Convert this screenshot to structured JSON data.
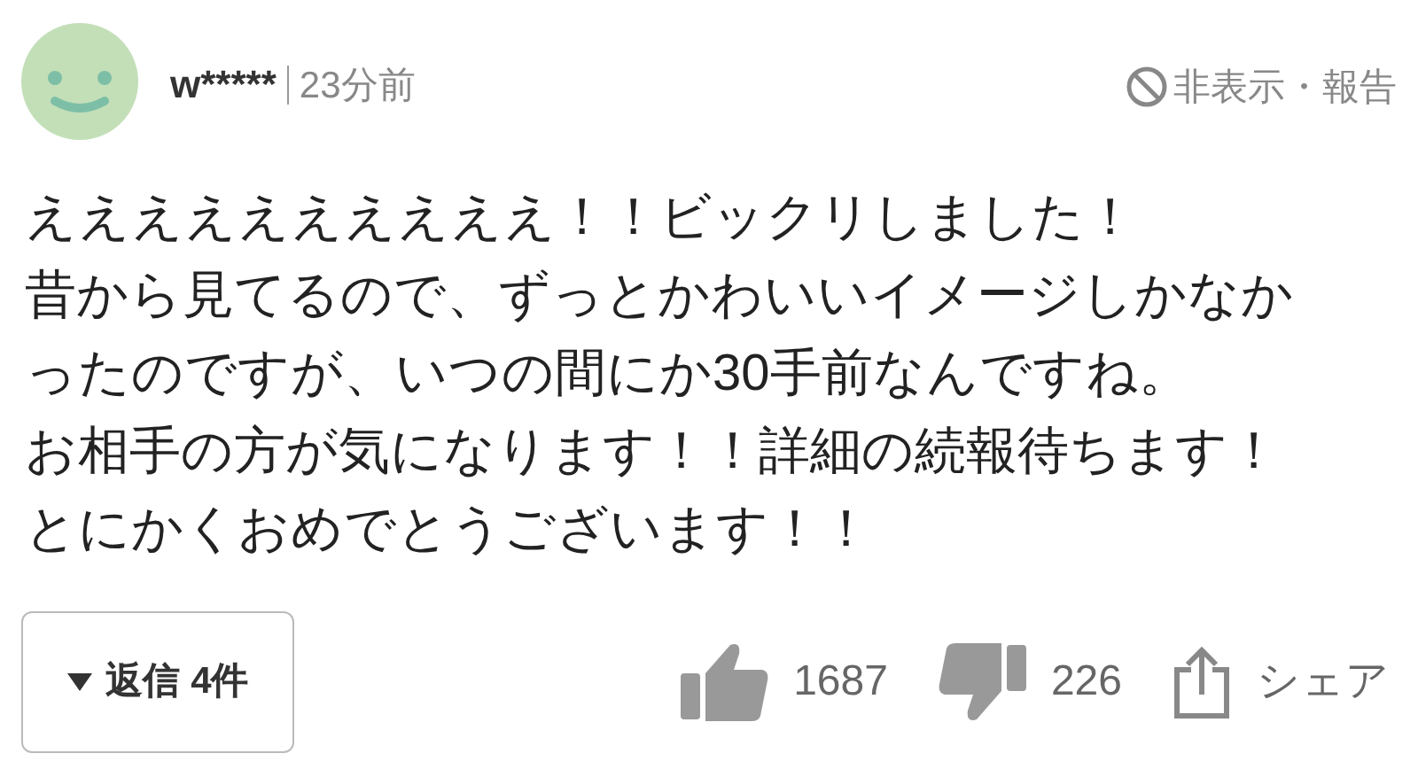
{
  "comment": {
    "user": "w*****",
    "time": "23分前",
    "hide_report": "非表示・報告",
    "body_lines": [
      "ええええええええええ！！ビックリしました！",
      "昔から見てるので、ずっとかわいいイメージしかなか",
      "ったのですが、いつの間にか30手前なんですね。",
      "お相手の方が気になります！！詳細の続報待ちます！",
      "とにかくおめでとうございます！！"
    ],
    "replies": "返信 4件",
    "likes": "1687",
    "dislikes": "226",
    "share": "シェア"
  }
}
